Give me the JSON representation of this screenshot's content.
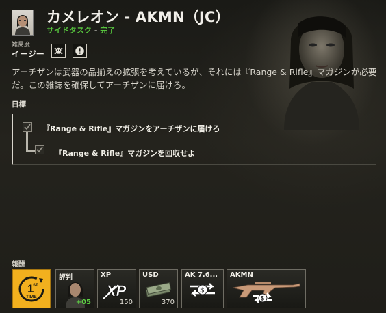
{
  "quest": {
    "title": "カメレオン - AKMN（JC）",
    "category": "サイドタスク",
    "separator": " - ",
    "status": "完了",
    "difficulty_label": "難易度",
    "difficulty_value": "イージー",
    "description": "アーチザンは武器の品揃えの拡張を考えているが、それには『Range & Rifle』マガジンが必要だ。この雑誌を確保してアーチザンに届けろ。"
  },
  "objectives": {
    "header": "目標",
    "items": [
      {
        "text": "『Range & Rifle』マガジンをアーチザンに届けろ",
        "checked": true
      },
      {
        "text": "『Range & Rifle』マガジンを回収せよ",
        "checked": true
      }
    ]
  },
  "rewards": {
    "label": "報酬",
    "items": [
      {
        "label": "1ST TIME",
        "icon": "first-time-badge",
        "color": "#f2b01e"
      },
      {
        "label": "評判",
        "value": "+05",
        "icon": "portrait"
      },
      {
        "label": "XP",
        "value": "150",
        "icon": "xp-logo"
      },
      {
        "label": "USD",
        "value": "370",
        "icon": "cash-stack"
      },
      {
        "label": "AK 7.6...",
        "icon": "swap-arrows-dollar"
      },
      {
        "label": "AKMN",
        "icon": "rifle-swap"
      }
    ]
  },
  "colors": {
    "accent_green": "#56c23d",
    "first_time_yellow": "#f2b01e"
  }
}
